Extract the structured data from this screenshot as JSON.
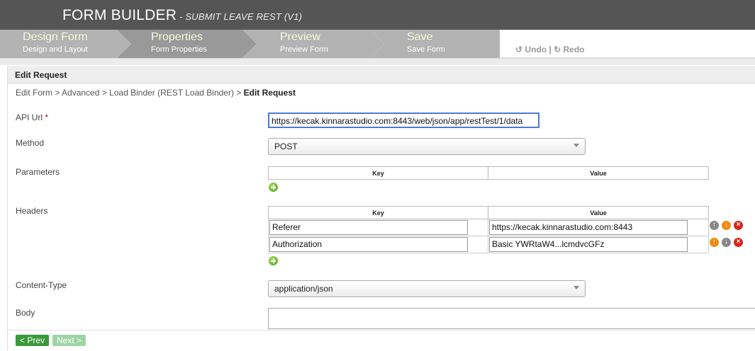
{
  "header": {
    "title": "FORM BUILDER",
    "subtitle": "- SUBMIT LEAVE REST (V1)"
  },
  "steps": [
    {
      "title": "Design Form",
      "subtitle": "Design and Layout"
    },
    {
      "title": "Properties",
      "subtitle": "Form Properties"
    },
    {
      "title": "Preview",
      "subtitle": "Preview Form"
    },
    {
      "title": "Save",
      "subtitle": "Save Form"
    }
  ],
  "history": {
    "undo": "Undo",
    "separator": "|",
    "redo": "Redo"
  },
  "panel": {
    "heading": "Edit Request",
    "breadcrumb": "Edit Form > Advanced > Load Binder (REST Load Binder) > ",
    "breadcrumb_current": "Edit Request"
  },
  "fields": {
    "api_url": {
      "label": "API Url",
      "required_mark": "*",
      "value": "https://kecak.kinnarastudio.com:8443/web/json/app/restTest/1/data"
    },
    "method": {
      "label": "Method",
      "value": "POST"
    },
    "parameters": {
      "label": "Parameters",
      "col_key": "Key",
      "col_value": "Value"
    },
    "headers": {
      "label": "Headers",
      "col_key": "Key",
      "col_value": "Value",
      "rows": [
        {
          "key": "Referer",
          "value": "https://kecak.kinnarastudio.com:8443"
        },
        {
          "key": "Authorization",
          "value": "Basic YWRtaW4...lcmdvcGFz"
        }
      ]
    },
    "content_type": {
      "label": "Content-Type",
      "value": "application/json"
    },
    "body": {
      "label": "Body"
    }
  },
  "nav": {
    "prev": "< Prev",
    "next": "Next >"
  },
  "colors": {
    "header_bg": "#555555",
    "step_active": "#999999",
    "step_inactive": "#b3b3b3",
    "prev_button": "#3a9a3a",
    "next_button": "#9fd5a6"
  }
}
